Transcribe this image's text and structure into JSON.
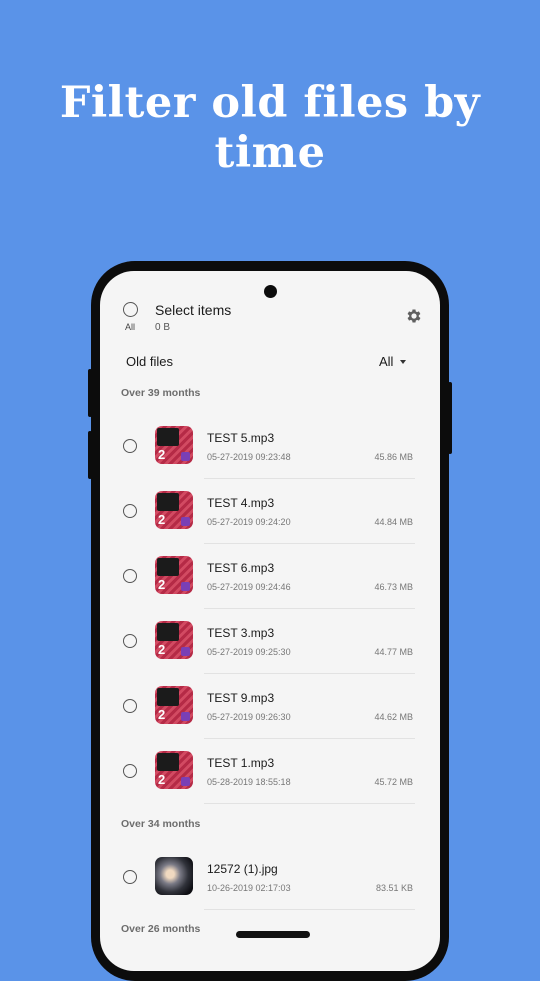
{
  "headline": "Filter old files by time",
  "header": {
    "select_all_label": "All",
    "title": "Select items",
    "selected_size": "0 B"
  },
  "toolbar": {
    "label": "Old files",
    "filter_value": "All"
  },
  "sections": [
    {
      "label": "Over 39 months",
      "files": [
        {
          "name": "TEST 5.mp3",
          "date": "05-27-2019 09:23:48",
          "size": "45.86 MB",
          "kind": "audio"
        },
        {
          "name": "TEST 4.mp3",
          "date": "05-27-2019 09:24:20",
          "size": "44.84 MB",
          "kind": "audio"
        },
        {
          "name": "TEST 6.mp3",
          "date": "05-27-2019 09:24:46",
          "size": "46.73 MB",
          "kind": "audio"
        },
        {
          "name": "TEST 3.mp3",
          "date": "05-27-2019 09:25:30",
          "size": "44.77 MB",
          "kind": "audio"
        },
        {
          "name": "TEST 9.mp3",
          "date": "05-27-2019 09:26:30",
          "size": "44.62 MB",
          "kind": "audio"
        },
        {
          "name": "TEST 1.mp3",
          "date": "05-28-2019 18:55:18",
          "size": "45.72 MB",
          "kind": "audio"
        }
      ]
    },
    {
      "label": "Over 34 months",
      "files": [
        {
          "name": "12572 (1).jpg",
          "date": "10-26-2019 02:17:03",
          "size": "83.51 KB",
          "kind": "image"
        }
      ]
    },
    {
      "label": "Over 26 months",
      "files": []
    }
  ],
  "icons": {
    "settings": "gear-icon",
    "filter_dropdown": "caret-down-icon",
    "checkbox": "radio-circle-icon"
  },
  "colors": {
    "background": "#5a93e8",
    "thumb_audio": "#b52a46"
  }
}
